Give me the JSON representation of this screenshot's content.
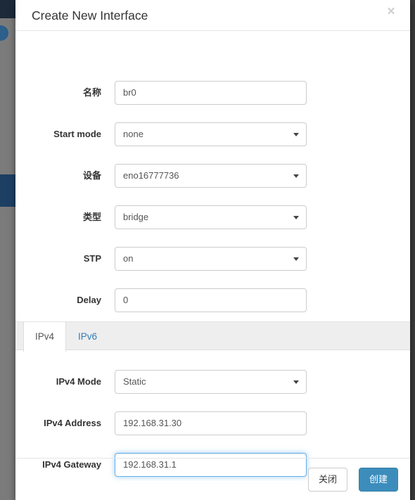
{
  "backdrop": {
    "sidebar_item_color": "#1d3f63",
    "topbar_color": "#1c2a3a",
    "avatar_color": "#2d5f8b"
  },
  "modal": {
    "title": "Create New Interface",
    "close_icon": "close-icon",
    "close_glyph": "×"
  },
  "form": {
    "fields": [
      {
        "label": "名称",
        "value": "br0",
        "type": "text"
      },
      {
        "label": "Start mode",
        "value": "none",
        "type": "select"
      },
      {
        "label": "设备",
        "value": "eno16777736",
        "type": "select"
      },
      {
        "label": "类型",
        "value": "bridge",
        "type": "select"
      },
      {
        "label": "STP",
        "value": "on",
        "type": "select"
      },
      {
        "label": "Delay",
        "value": "0",
        "type": "text"
      }
    ]
  },
  "tabs": [
    {
      "label": "IPv4",
      "active": true
    },
    {
      "label": "IPv6",
      "active": false
    }
  ],
  "ipv4": {
    "fields": [
      {
        "label": "IPv4 Mode",
        "value": "Static",
        "type": "select",
        "focused": false
      },
      {
        "label": "IPv4 Address",
        "value": "192.168.31.30",
        "type": "text",
        "focused": false
      },
      {
        "label": "IPv4 Gateway",
        "value": "192.168.31.1",
        "type": "text",
        "focused": true
      }
    ]
  },
  "footer": {
    "close_label": "关闭",
    "create_label": "创建",
    "create_color": "#3c8dbc"
  }
}
